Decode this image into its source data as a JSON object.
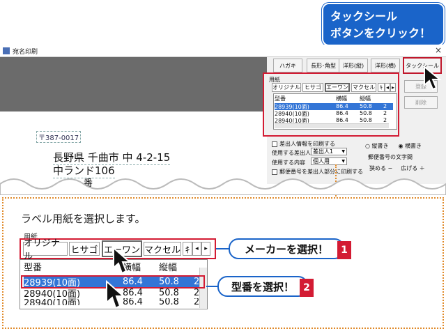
{
  "callout_top": {
    "line1": "タックシール",
    "line2": "ボタンをクリック！"
  },
  "window": {
    "title": "宛名印刷",
    "close": "×",
    "toolbar": [
      "ハガキ",
      "長形･角型",
      "洋形(縦)",
      "洋形(横)",
      "タックシール"
    ],
    "side_buttons": [
      "登録",
      "削除"
    ]
  },
  "preview": {
    "postal": "〒387-0017",
    "address1": "長野県 千曲市 中 4-2-15",
    "address2": "中ランド106",
    "address3": "番"
  },
  "paper_panel": {
    "group_label": "用紙",
    "tabs": [
      "オリジナル",
      "ヒサゴ",
      "エーワン",
      "マクセル",
      "ｷ",
      "◂",
      "▸"
    ],
    "columns": [
      "型番",
      "横幅",
      "縦幅",
      ""
    ],
    "rows": [
      [
        "28939(10面)",
        "86.4",
        "50.8",
        "2"
      ],
      [
        "28940(10面)",
        "86.4",
        "50.8",
        "2"
      ],
      [
        "28940(10面)",
        "86.4",
        "50.8",
        "2"
      ]
    ]
  },
  "options": {
    "print_sender": "差出人情報を印刷する",
    "sender_label": "使用する差出人",
    "sender_value": "差出人1",
    "content_label": "使用する内容",
    "content_value": "個人用",
    "postal_print": "郵便番号を差出人部分に印刷する",
    "orientation_vertical": "縦書き",
    "orientation_horizontal": "横書き",
    "postal_spacing_label": "郵便番号の文字間",
    "narrow": "狭める",
    "widen": "広げる"
  },
  "lower": {
    "heading": "ラベル用紙を選択します。",
    "group_label": "用紙",
    "tabs": [
      "オリジナル",
      "ヒサゴ",
      "エーワン",
      "マクセル",
      "ｷ",
      "◂",
      "▸"
    ],
    "columns": [
      "型番",
      "横幅",
      "縦幅",
      ""
    ],
    "rows": [
      [
        "28939(10面)",
        "86.4",
        "50.8",
        "2"
      ],
      [
        "28940(10面)",
        "86.4",
        "50.8",
        "2"
      ],
      [
        "28940(10面)",
        "86.4",
        "50.8",
        "2"
      ]
    ],
    "callout_maker": "メーカーを選択！",
    "callout_model": "型番を選択！",
    "num1": "1",
    "num2": "2"
  },
  "colors": {
    "accent_blue": "#1a64c9",
    "highlight_red": "#d31b33",
    "selection": "#3375d6"
  }
}
